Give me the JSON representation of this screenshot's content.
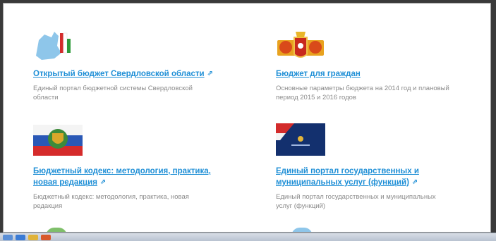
{
  "cards": [
    {
      "id": "open-budget",
      "title": "Открытый бюджет Свердловской области",
      "description": "Единый портал бюджетной системы Свердловской области",
      "icon": "map-flag-icon"
    },
    {
      "id": "budget-citizens",
      "title": "Бюджет для граждан",
      "description": "Основные параметры бюджета на 2014 год и плановый период 2015 и 2016 годов",
      "icon": "coat-of-arms-icon"
    },
    {
      "id": "budget-code",
      "title": "Бюджетный кодекс: методология, практика, новая редакция",
      "description": "Бюджетный кодекс: методология, практика, новая редакция",
      "icon": "russian-flag-emblem-icon"
    },
    {
      "id": "gosuslugi",
      "title": "Единый портал государственных и муниципальных услуг (функций)",
      "description": "Единый портал государственных и муниципальных услуг (функций)",
      "icon": "gosuslugi-banner-icon"
    }
  ],
  "colors": {
    "link": "#1f8fd6",
    "description": "#8a8a8a"
  },
  "external_icon": "external-link-icon"
}
